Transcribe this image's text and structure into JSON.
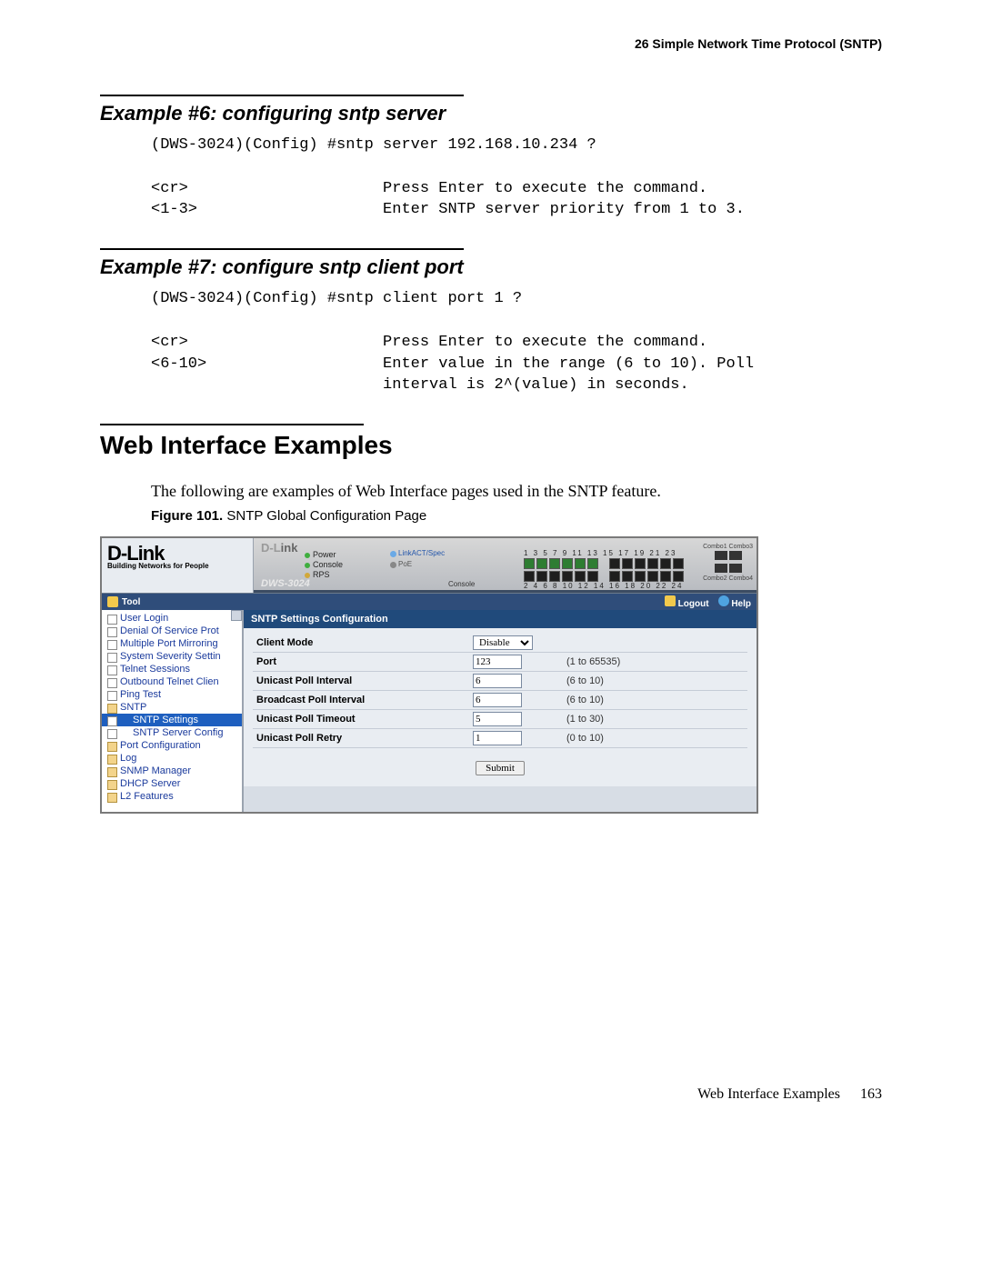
{
  "running_head": "26    Simple Network Time Protocol (SNTP)",
  "example6": {
    "title": "Example #6: configuring sntp server",
    "cli": "(DWS-3024)(Config) #sntp server 192.168.10.234 ?\n\n<cr>                     Press Enter to execute the command.\n<1-3>                    Enter SNTP server priority from 1 to 3."
  },
  "example7": {
    "title": "Example #7: configure sntp client port",
    "cli": "(DWS-3024)(Config) #sntp client port 1 ?\n\n<cr>                     Press Enter to execute the command.\n<6-10>                   Enter value in the range (6 to 10). Poll\n                         interval is 2^(value) in seconds."
  },
  "web_section_title": "Web Interface Examples",
  "web_intro": "The following are examples of Web Interface pages used in the SNTP feature.",
  "figure_caption_bold": "Figure 101. ",
  "figure_caption_rest": "SNTP Global Configuration Page",
  "footer_text": "Web Interface Examples",
  "footer_page": "163",
  "shot": {
    "brand": "D-Link",
    "tagline": "Building Networks for People",
    "banner_brand_prefix": "D-L",
    "banner_brand_rest": "ink",
    "banner_leds": {
      "power": "Power",
      "console": "Console",
      "rps": "RPS"
    },
    "banner_link": "LinkACT/Spec",
    "banner_poe": "PoE",
    "banner_model": "DWS-3024",
    "banner_console": "Console",
    "port_top_nums": "1  3  5  7  9  11        13 15 17 19 21 23",
    "port_bot_nums": "2  4  6  8 10 12        14 16 18 20 22 24",
    "combo_top": "Combo1 Combo3",
    "combo_bot": "Combo2 Combo4",
    "toolbar": {
      "tool": "Tool",
      "logout": "Logout",
      "help": "Help"
    },
    "tree": [
      {
        "label": "User Login",
        "cls": ""
      },
      {
        "label": "Denial Of Service Prot",
        "cls": ""
      },
      {
        "label": "Multiple Port Mirroring",
        "cls": ""
      },
      {
        "label": "System Severity Settin",
        "cls": ""
      },
      {
        "label": "Telnet Sessions",
        "cls": ""
      },
      {
        "label": "Outbound Telnet Clien",
        "cls": ""
      },
      {
        "label": "Ping Test",
        "cls": ""
      },
      {
        "label": "SNTP",
        "cls": "fld"
      },
      {
        "label": "SNTP Settings",
        "cls": "sub sel"
      },
      {
        "label": "SNTP Server Config",
        "cls": "sub"
      },
      {
        "label": "Port Configuration",
        "cls": "fld"
      },
      {
        "label": "Log",
        "cls": "fld"
      },
      {
        "label": "SNMP Manager",
        "cls": "fld"
      },
      {
        "label": "DHCP Server",
        "cls": "fld"
      },
      {
        "label": "L2 Features",
        "cls": "fld"
      }
    ],
    "panel_title": "SNTP Settings Configuration",
    "fields": [
      {
        "label": "Client Mode",
        "type": "select",
        "value": "Disable",
        "hint": ""
      },
      {
        "label": "Port",
        "type": "text",
        "value": "123",
        "hint": "(1 to 65535)"
      },
      {
        "label": "Unicast Poll Interval",
        "type": "text",
        "value": "6",
        "hint": "(6 to 10)"
      },
      {
        "label": "Broadcast Poll Interval",
        "type": "text",
        "value": "6",
        "hint": "(6 to 10)"
      },
      {
        "label": "Unicast Poll Timeout",
        "type": "text",
        "value": "5",
        "hint": "(1 to 30)"
      },
      {
        "label": "Unicast Poll Retry",
        "type": "text",
        "value": "1",
        "hint": "(0 to 10)"
      }
    ],
    "submit": "Submit"
  }
}
